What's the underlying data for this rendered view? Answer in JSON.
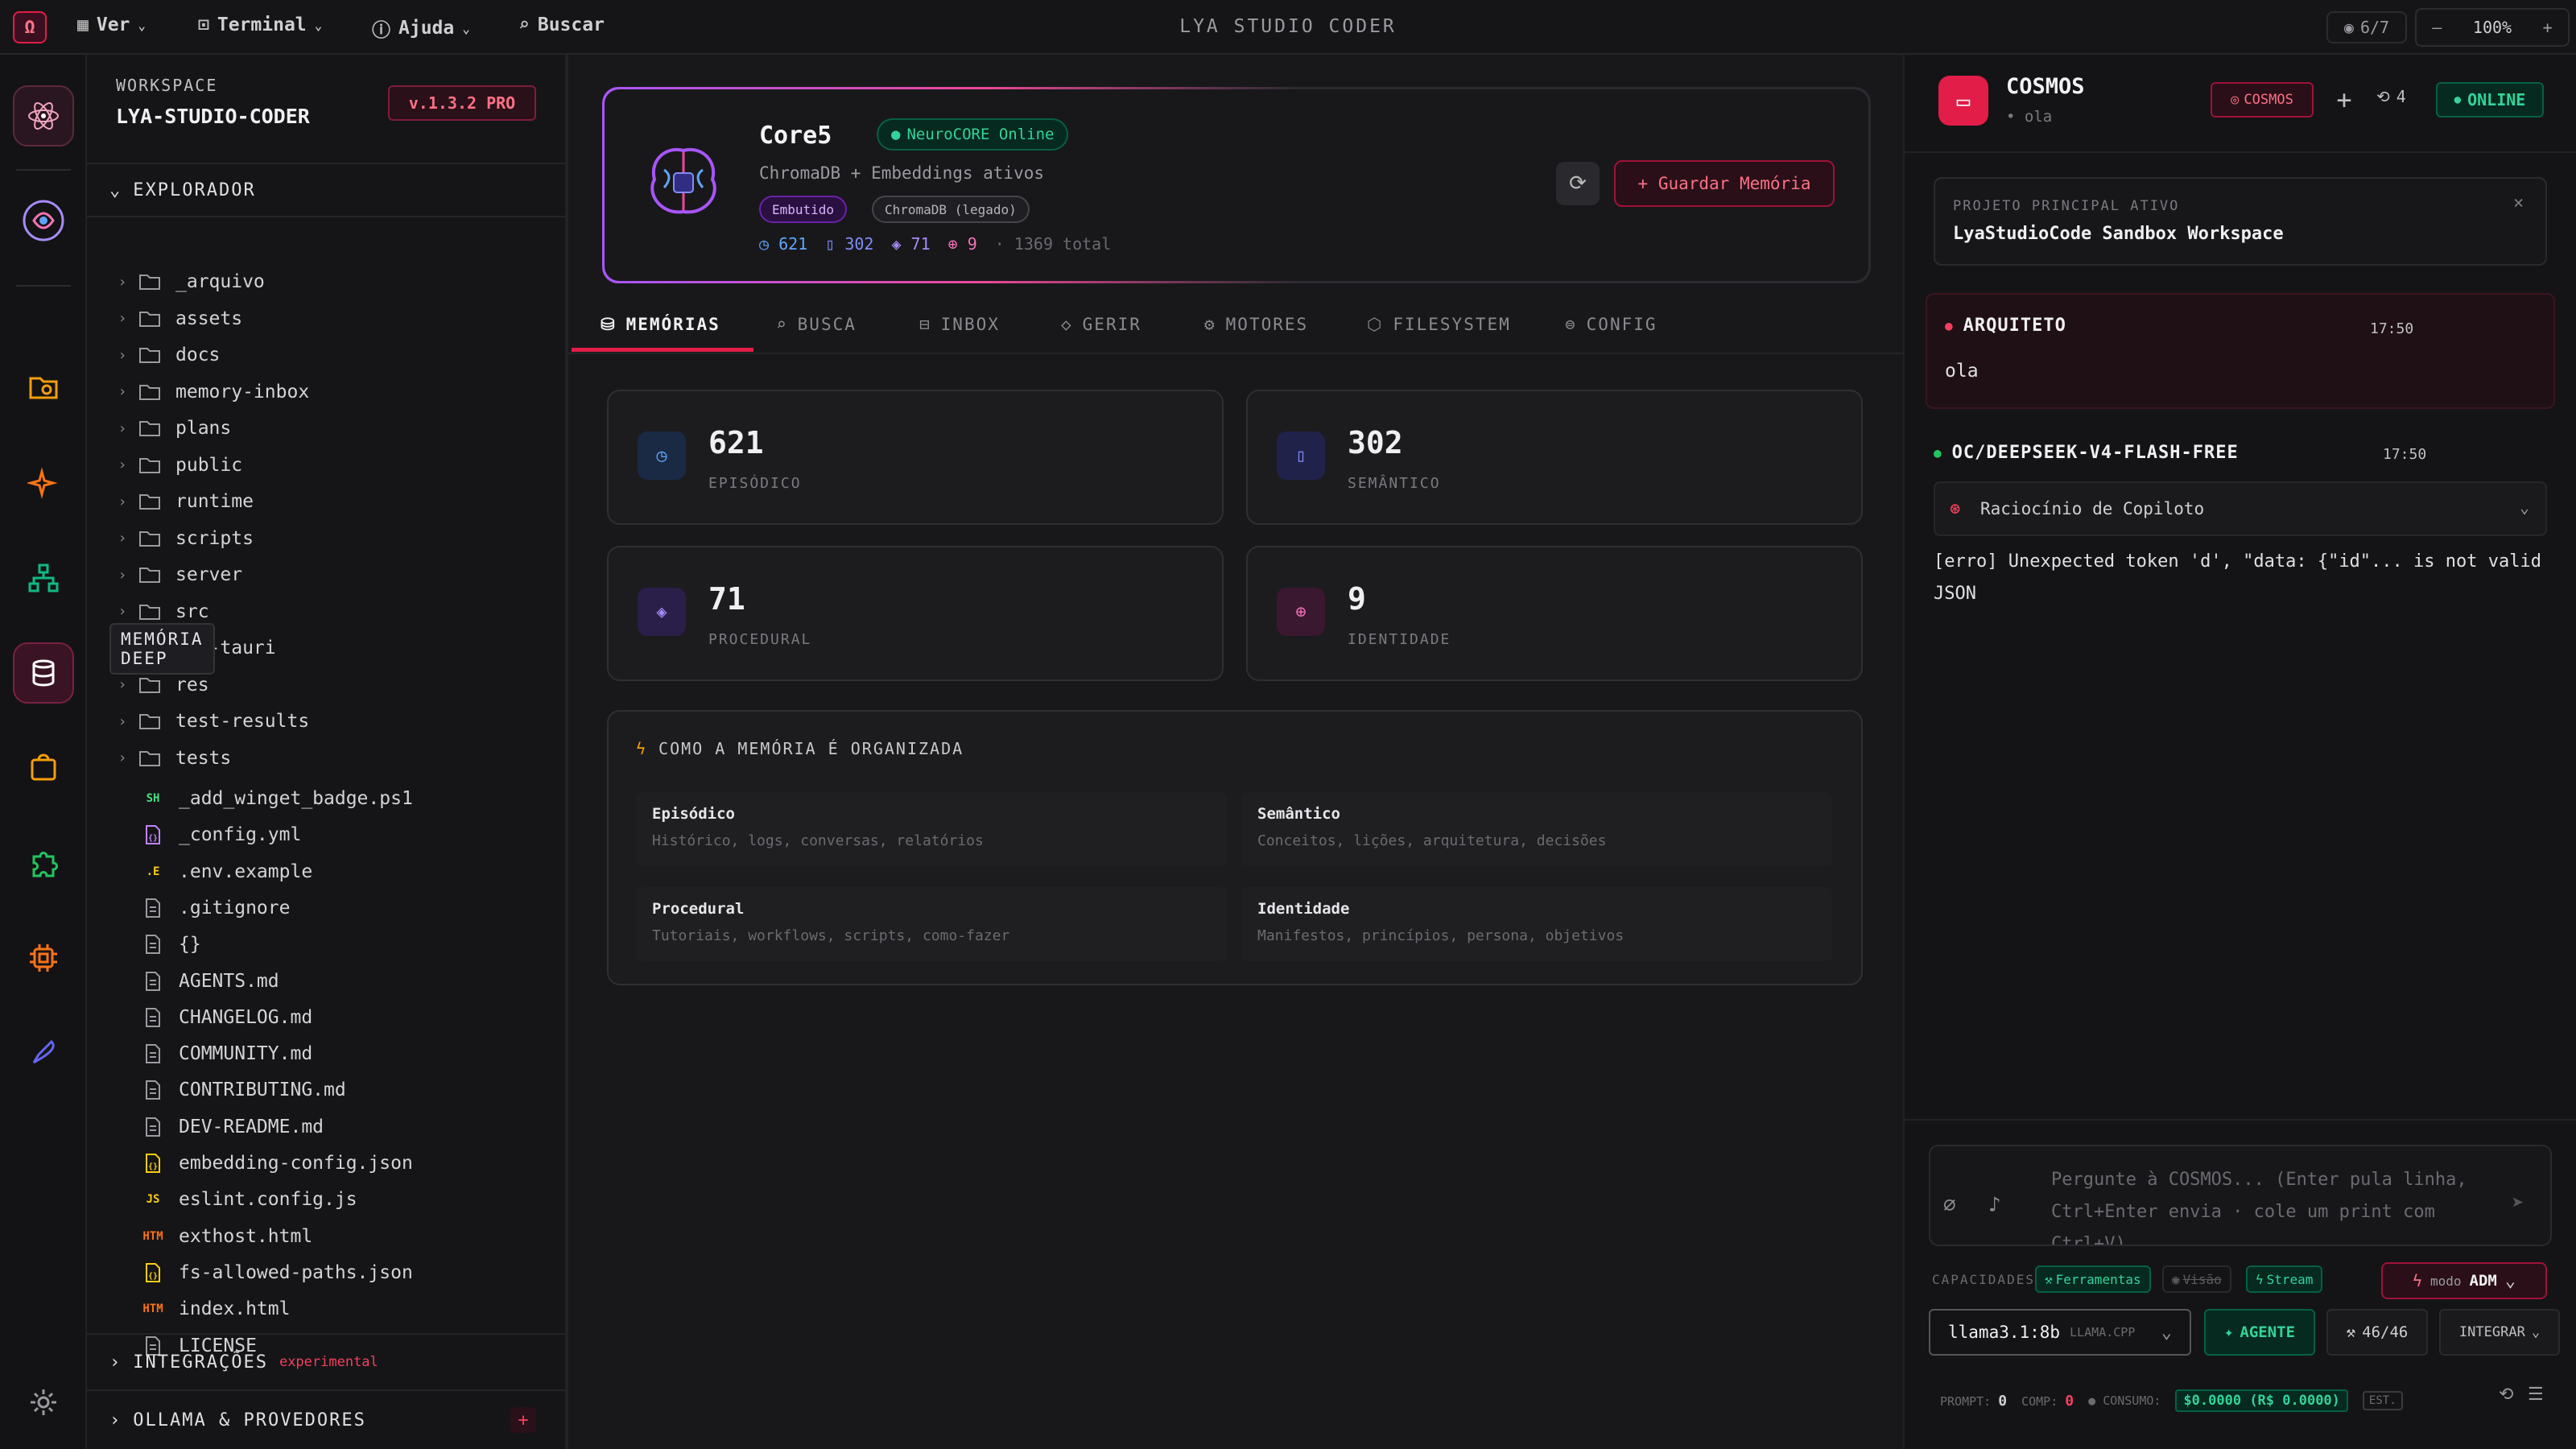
{
  "topbar": {
    "logo": "Ω",
    "menu": [
      "Ver",
      "Terminal",
      "Ajuda",
      "Buscar"
    ],
    "title": "LYA STUDIO CODER",
    "views": "6/7",
    "zoom_minus": "–",
    "zoom": "100%",
    "zoom_plus": "+"
  },
  "rail": {
    "tooltip": "MEMÓRIA DEEP",
    "icons": [
      "atom-icon",
      "brain-icon",
      "folder-search-icon",
      "sparkle-icon",
      "network-icon",
      "database-icon",
      "package-icon",
      "puzzle-icon",
      "cpu-icon",
      "rocket-icon",
      "settings-icon"
    ]
  },
  "sidebar": {
    "workspace_label": "WORKSPACE",
    "workspace_name": "LYA-STUDIO-CODER",
    "version": "v.1.3.2 PRO",
    "explorer": "EXPLORADOR",
    "folders": [
      "_arquivo",
      "assets",
      "docs",
      "memory-inbox",
      "plans",
      "public",
      "runtime",
      "scripts",
      "server",
      "src",
      "src-tauri",
      "res",
      "test-results",
      "tests"
    ],
    "files": [
      {
        "badge": "SH",
        "name": "_add_winget_badge.ps1",
        "color": "#4ade80"
      },
      {
        "badge": "{}",
        "name": "_config.yml",
        "color": "#c084fc"
      },
      {
        "badge": ".E",
        "name": ".env.example",
        "color": "#facc15"
      },
      {
        "badge": "doc",
        "name": ".gitignore",
        "color": "#9a9aa0"
      },
      {
        "badge": "doc",
        "name": "{}",
        "color": "#9a9aa0"
      },
      {
        "badge": "doc",
        "name": "AGENTS.md",
        "color": "#9a9aa0"
      },
      {
        "badge": "doc",
        "name": "CHANGELOG.md",
        "color": "#9a9aa0"
      },
      {
        "badge": "doc",
        "name": "COMMUNITY.md",
        "color": "#9a9aa0"
      },
      {
        "badge": "doc",
        "name": "CONTRIBUTING.md",
        "color": "#9a9aa0"
      },
      {
        "badge": "doc",
        "name": "DEV-README.md",
        "color": "#9a9aa0"
      },
      {
        "badge": "{}",
        "name": "embedding-config.json",
        "color": "#facc15"
      },
      {
        "badge": "JS",
        "name": "eslint.config.js",
        "color": "#facc15"
      },
      {
        "badge": "HTM",
        "name": "exthost.html",
        "color": "#f97316"
      },
      {
        "badge": "{}",
        "name": "fs-allowed-paths.json",
        "color": "#facc15"
      },
      {
        "badge": "HTM",
        "name": "index.html",
        "color": "#f97316"
      },
      {
        "badge": "doc",
        "name": "LICENSE",
        "color": "#9a9aa0"
      }
    ],
    "integrations": "INTEGRAÇÕES",
    "integrations_tag": "experimental",
    "ollama": "OLLAMA & PROVEDORES",
    "ollama_add": "+"
  },
  "core": {
    "name": "Core5",
    "status": "NeuroCORE Online",
    "subtitle": "ChromaDB + Embeddings ativos",
    "tag1": "Embutido",
    "tag2": "ChromaDB (legado)",
    "counts": [
      "621",
      "302",
      "71",
      "9"
    ],
    "total": "· 1369 total",
    "save_button": "+ Guardar Memória"
  },
  "tabs": [
    "MEMÓRIAS",
    "BUSCA",
    "INBOX",
    "GERIR",
    "MOTORES",
    "FILESYSTEM",
    "CONFIG"
  ],
  "stats": [
    {
      "value": "621",
      "label": "EPISÓDICO",
      "color": "#60a5fa"
    },
    {
      "value": "302",
      "label": "SEMÂNTICO",
      "color": "#818cf8"
    },
    {
      "value": "71",
      "label": "PROCEDURAL",
      "color": "#a78bfa"
    },
    {
      "value": "9",
      "label": "IDENTIDADE",
      "color": "#f472b6"
    }
  ],
  "organization": {
    "title": "COMO A MEMÓRIA É ORGANIZADA",
    "items": [
      {
        "name": "Episódico",
        "desc": "Histórico, logs, conversas, relatórios"
      },
      {
        "name": "Semântico",
        "desc": "Conceitos, lições, arquitetura, decisões"
      },
      {
        "name": "Procedural",
        "desc": "Tutoriais, workflows, scripts, como-fazer"
      },
      {
        "name": "Identidade",
        "desc": "Manifestos, princípios, persona, objetivos"
      }
    ]
  },
  "chat": {
    "title": "COSMOS",
    "subtitle": "• ola",
    "badge": "COSMOS",
    "add": "+",
    "history_count": "4",
    "online": "ONLINE",
    "project_label": "PROJETO PRINCIPAL ATIVO",
    "project_name": "LyaStudioCode Sandbox Workspace",
    "msg1_author": "ARQUITETO",
    "msg1_time": "17:50",
    "msg1_text": "ola",
    "msg2_author": "OC/DEEPSEEK-V4-FLASH-FREE",
    "msg2_time": "17:50",
    "reasoning": "Raciocínio de Copiloto",
    "msg2_text": "[erro] Unexpected token 'd', \"data: {\"id\"... is not valid JSON",
    "placeholder": "Pergunte à COSMOS... (Enter pula linha, Ctrl+Enter envia · cole um print com Ctrl+V)",
    "cap_label": "CAPACIDADES",
    "caps": [
      "Ferramentas",
      "Visão",
      "Stream"
    ],
    "mode_label": "modo",
    "mode_value": "ADM",
    "model": "llama3.1:8b",
    "model_engine": "LLAMA.CPP",
    "agent": "AGENTE",
    "tools": "46/46",
    "integrate": "INTEGRAR",
    "prompt_label": "PROMPT:",
    "prompt_val": "0",
    "comp_label": "COMP:",
    "comp_val": "0",
    "consumo_label": "CONSUMO:",
    "consumo_val": "$0.0000 (R$ 0.0000)",
    "est": "EST."
  }
}
